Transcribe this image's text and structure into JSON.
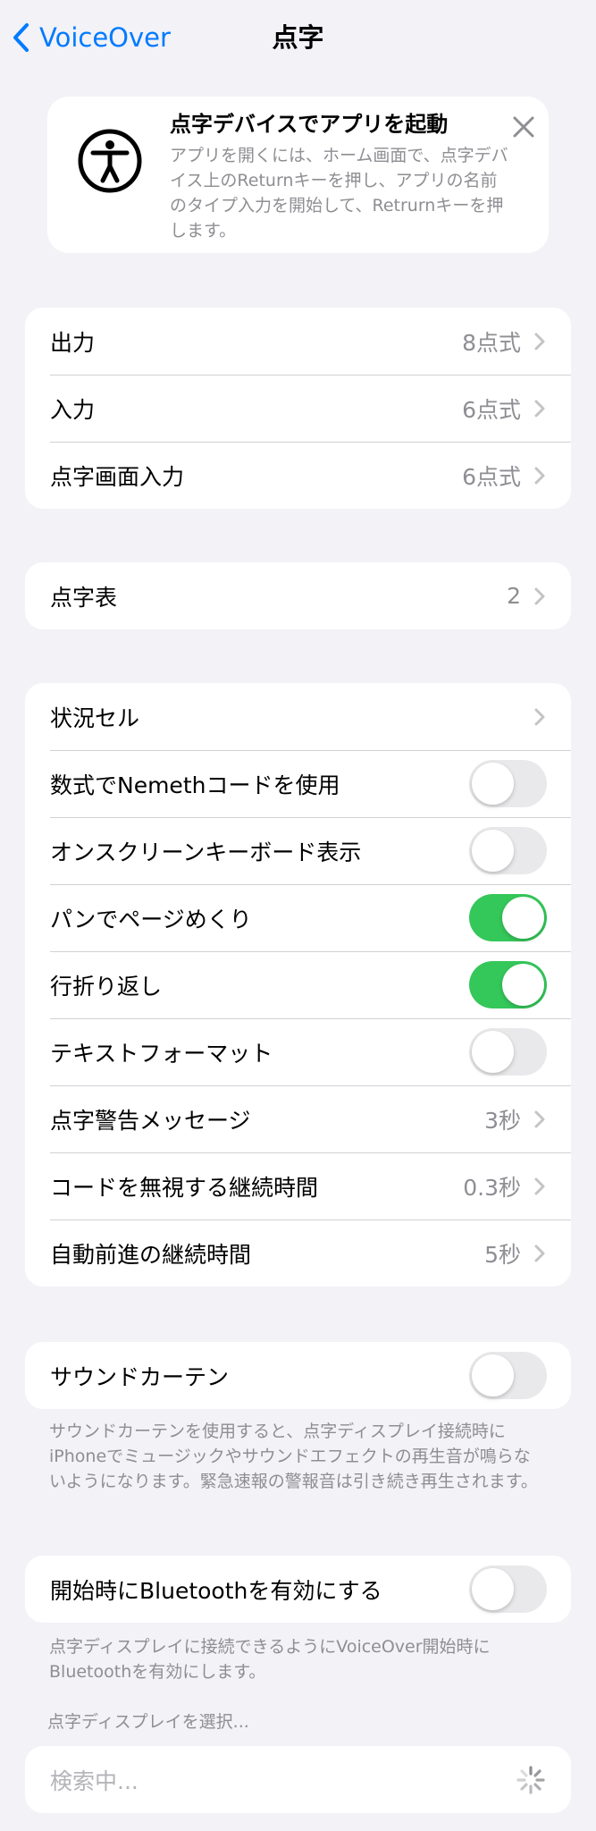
{
  "nav": {
    "back_label": "VoiceOver",
    "title": "点字"
  },
  "tip": {
    "title": "点字デバイスでアプリを起動",
    "body": "アプリを開くには、ホーム画面で、点字デバイス上のReturnキーを押し、アプリの名前のタイプ入力を開始して、Retrurnキーを押します。"
  },
  "group1": {
    "rows": [
      {
        "label": "出力",
        "value": "8点式"
      },
      {
        "label": "入力",
        "value": "6点式"
      },
      {
        "label": "点字画面入力",
        "value": "6点式"
      }
    ]
  },
  "group2": {
    "rows": [
      {
        "label": "点字表",
        "value": "2"
      }
    ]
  },
  "group3": {
    "status_cell": {
      "label": "状況セル"
    },
    "nemeth": {
      "label": "数式でNemethコードを使用",
      "on": false
    },
    "onscreen_keyboard": {
      "label": "オンスクリーンキーボード表示",
      "on": false
    },
    "pan_page": {
      "label": "パンでページめくり",
      "on": true
    },
    "word_wrap": {
      "label": "行折り返し",
      "on": true
    },
    "text_format": {
      "label": "テキストフォーマット",
      "on": false
    },
    "alert_messages": {
      "label": "点字警告メッセージ",
      "value": "3秒"
    },
    "ignore_chord": {
      "label": "コードを無視する継続時間",
      "value": "0.3秒"
    },
    "auto_advance": {
      "label": "自動前進の継続時間",
      "value": "5秒"
    }
  },
  "sound_curtain": {
    "label": "サウンドカーテン",
    "on": false,
    "footer": "サウンドカーテンを使用すると、点字ディスプレイ接続時にiPhoneでミュージックやサウンドエフェクトの再生音が鳴らないようになります。緊急速報の警報音は引き続き再生されます。"
  },
  "bluetooth": {
    "label": "開始時にBluetoothを有効にする",
    "on": false,
    "footer": "点字ディスプレイに接続できるようにVoiceOver開始時にBluetoothを有効にします。"
  },
  "display_select": {
    "header": "点字ディスプレイを選択...",
    "searching": "検索中..."
  },
  "colors": {
    "accent": "#007aff",
    "toggle_on": "#34c759",
    "toggle_off": "#e9e9eb",
    "secondary_text": "#8e8e93",
    "background": "#f2f2f7"
  }
}
